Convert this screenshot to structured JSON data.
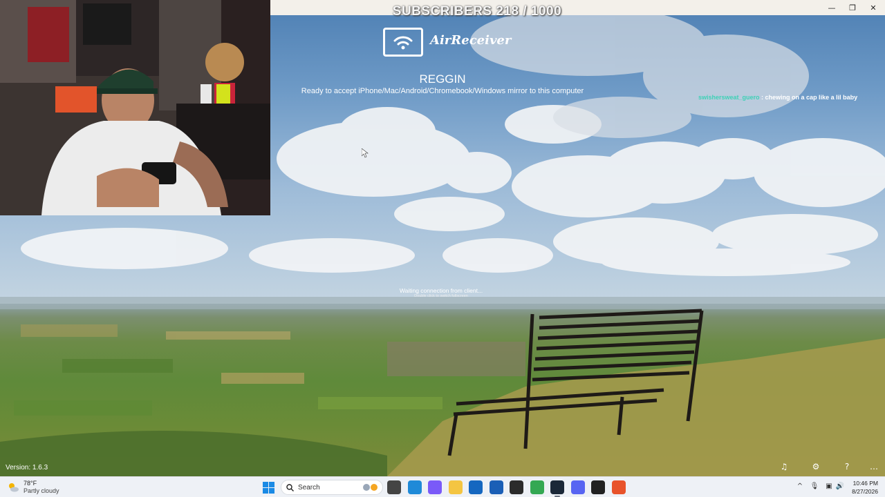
{
  "overlay": {
    "subscribers": "SUBSCRIBERS 218 / 1000"
  },
  "app": {
    "logo_text": "AirReceiver",
    "device_name": "REGGIN",
    "ready_text": "Ready to accept iPhone/Mac/Android/Chromebook/Windows mirror to this computer",
    "waiting_text": "Waiting connection from client...",
    "waiting_subtext": "Double click to switch fullscreen",
    "version": "Version: 1.6.3"
  },
  "chat": {
    "username": "swishersweat_guero",
    "separator": " : ",
    "message": "chewing on a cap like a lil baby"
  },
  "window_controls": {
    "minimize": "—",
    "maximize": "❐",
    "close": "✕"
  },
  "toolbar_icons": [
    "music-note-icon",
    "settings-icon",
    "help-icon",
    "more-icon"
  ],
  "toolbar_glyphs": {
    "music": "♫",
    "settings": "⚙",
    "help": "?",
    "more": "…"
  },
  "taskbar": {
    "weather": {
      "temp": "78°F",
      "condition": "Partly cloudy"
    },
    "search_placeholder": "Search",
    "apps": [
      {
        "name": "task-view",
        "color": "#444444"
      },
      {
        "name": "edge",
        "color": "#1f8ad8"
      },
      {
        "name": "copilot",
        "color": "#7a5af8"
      },
      {
        "name": "file-explorer",
        "color": "#f4c542"
      },
      {
        "name": "outlook",
        "color": "#1567c0"
      },
      {
        "name": "microsoft-store",
        "color": "#1b5fb6"
      },
      {
        "name": "obs",
        "color": "#2b2b2b"
      },
      {
        "name": "chrome",
        "color": "#34a853"
      },
      {
        "name": "steam",
        "color": "#1b2838"
      },
      {
        "name": "discord",
        "color": "#5865f2"
      },
      {
        "name": "epic-games",
        "color": "#222222"
      },
      {
        "name": "airreceiver",
        "color": "#e8532b"
      }
    ],
    "clock": {
      "time": "10:46 PM",
      "date": "8/27/2026"
    }
  }
}
